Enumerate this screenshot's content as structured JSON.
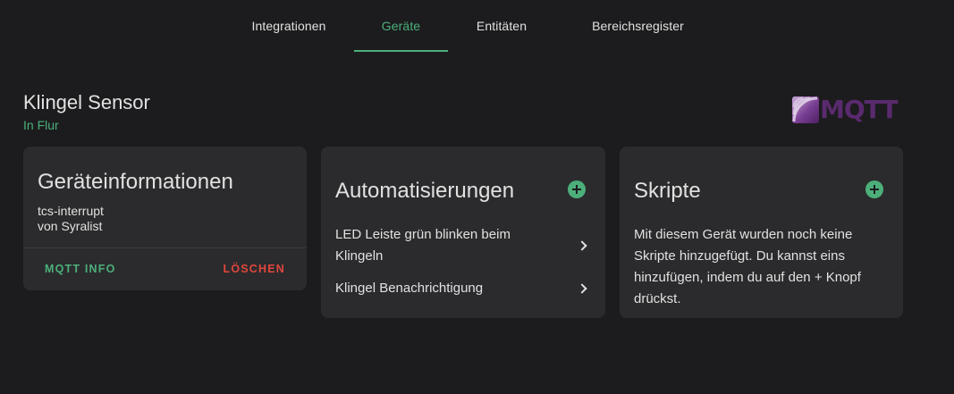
{
  "tabs": [
    {
      "label": "Integrationen",
      "active": false
    },
    {
      "label": "Geräte",
      "active": true
    },
    {
      "label": "Entitäten",
      "active": false
    },
    {
      "label": "Bereichsregister",
      "active": false
    }
  ],
  "device": {
    "name": "Klingel Sensor",
    "area": "In Flur"
  },
  "logo": {
    "text": "MQTT",
    "icon": "mqtt-logo"
  },
  "info_card": {
    "title": "Geräteinformationen",
    "model": "tcs-interrupt",
    "manufacturer": "von Syralist",
    "mqtt_info_label": "MQTT INFO",
    "delete_label": "LÖSCHEN"
  },
  "automations_card": {
    "title": "Automatisierungen",
    "add_icon": "plus-circle-icon",
    "items": [
      {
        "label": "LED Leiste grün blinken beim Klingeln"
      },
      {
        "label": "Klingel Benachrichtigung"
      }
    ]
  },
  "scripts_card": {
    "title": "Skripte",
    "add_icon": "plus-circle-icon",
    "empty_text": "Mit diesem Gerät wurden noch keine Skripte hinzugefügt. Du kannst eins hinzufügen, indem du auf den + Knopf drückst."
  },
  "colors": {
    "background": "#1c1c1e",
    "card": "#2b2b2d",
    "accent": "#4caf7a",
    "danger": "#e0463c",
    "text": "#e1e1e1"
  }
}
